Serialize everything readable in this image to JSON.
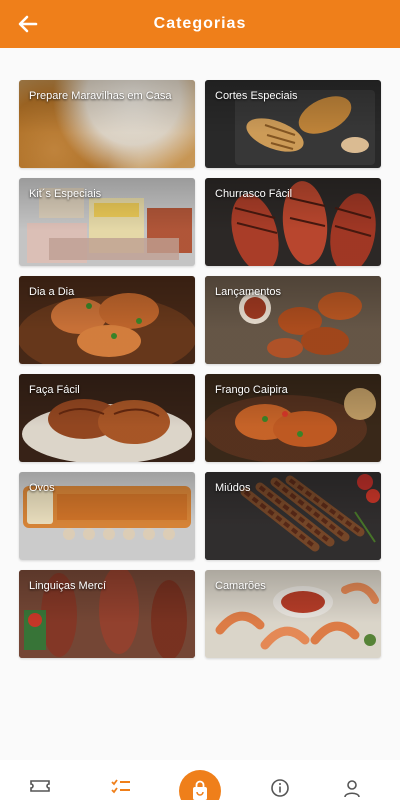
{
  "header": {
    "title": "Categorias"
  },
  "colors": {
    "primary": "#ef7f1a",
    "background": "#fafafa",
    "text_on_primary": "#ffffff"
  },
  "icons": {
    "back": "arrow-left-icon",
    "nav": [
      "ticket-icon",
      "list-icon",
      "shopping-bag-icon",
      "info-icon",
      "user-icon"
    ]
  },
  "categories": [
    {
      "label": "Prepare Maravilhas em Casa"
    },
    {
      "label": "Cortes Especiais"
    },
    {
      "label": "Kit´s Especiais"
    },
    {
      "label": "Churrasco Fácil"
    },
    {
      "label": "Dia a Dia"
    },
    {
      "label": "Lançamentos"
    },
    {
      "label": "Faça Fácil"
    },
    {
      "label": "Frango Caipira"
    },
    {
      "label": "Ovos"
    },
    {
      "label": "Miúdos"
    },
    {
      "label": "Linguiças Mercí"
    },
    {
      "label": "Camarões"
    }
  ]
}
